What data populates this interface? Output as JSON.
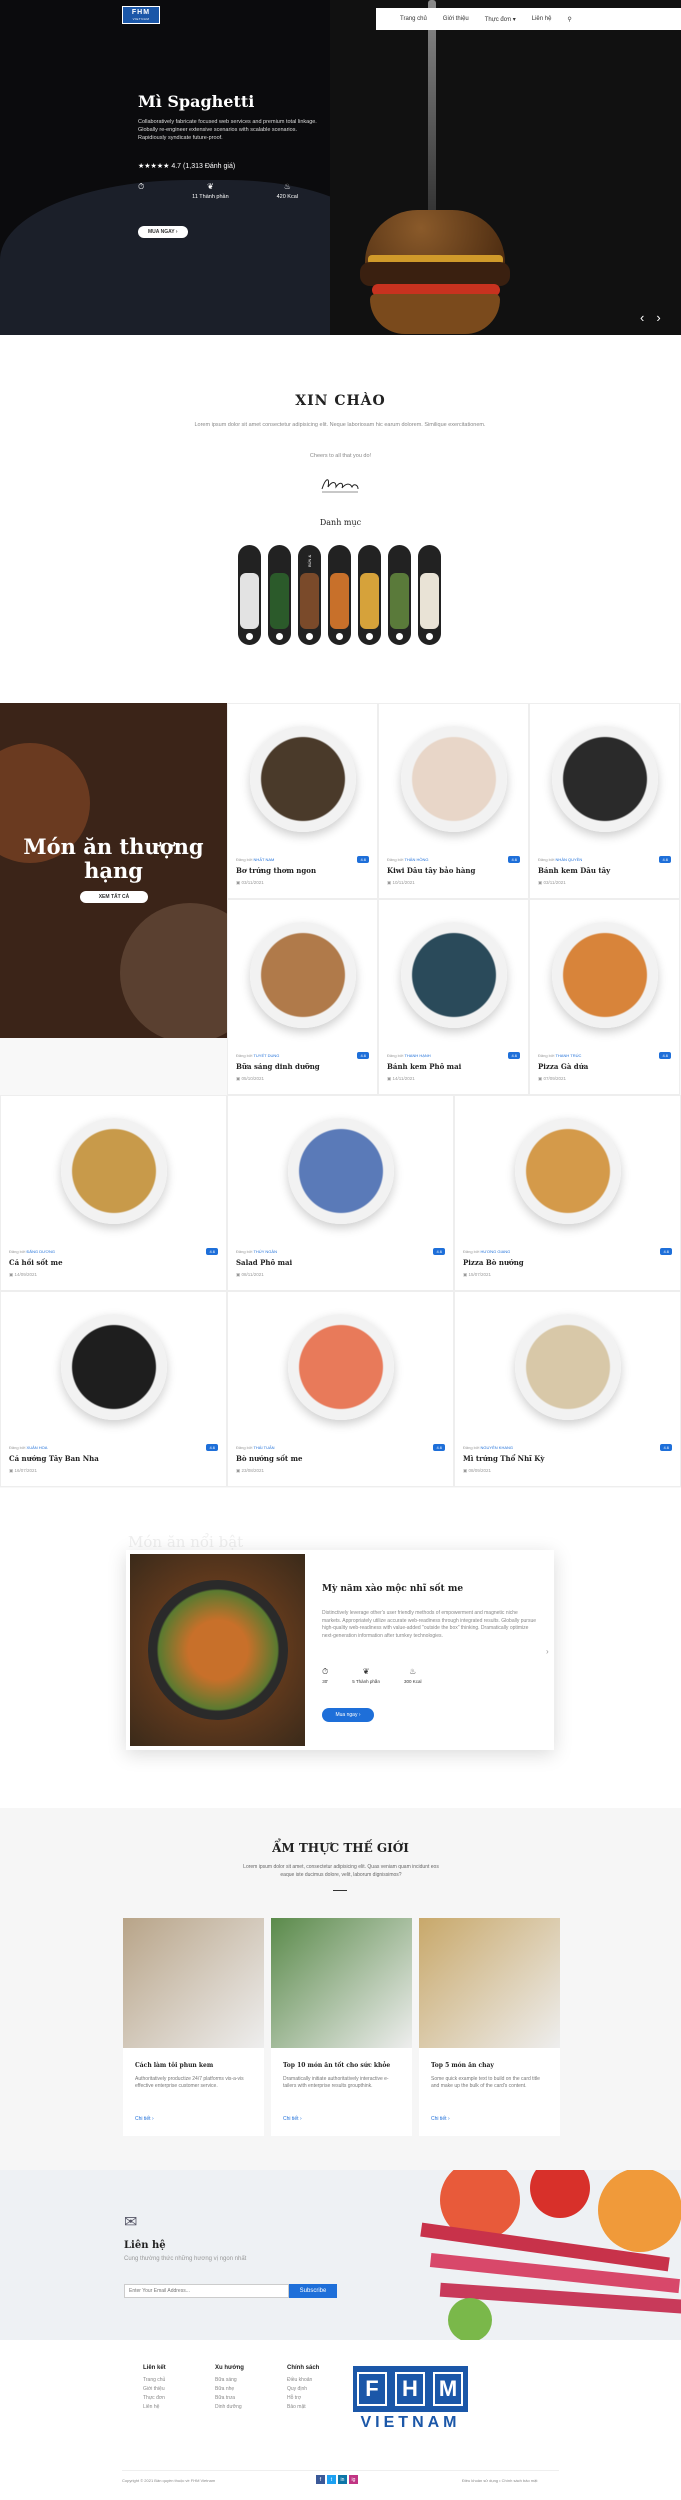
{
  "header": {
    "logo_main": "FHM",
    "logo_sub": "VIETNAM",
    "nav": [
      "Trang chủ",
      "Giới thiệu",
      "Thực đơn",
      "Liên hệ"
    ],
    "nav_dropdown_icon": "chevron-down-icon",
    "search_icon": "search-icon"
  },
  "hero": {
    "title": "Mì Spaghetti",
    "description": "Collaboratively fabricate focused web services and premium total linkage. Globally re-engineer extensive scenarios with scalable scenarios. Rapidiously syndicate future-proof.",
    "stars": "★★★★★",
    "rating_text": "4.7 (1,313 Đánh giá)",
    "stats": [
      {
        "icon": "timer-icon",
        "label": ""
      },
      {
        "icon": "ingredients-icon",
        "label": "11 Thành phần"
      },
      {
        "icon": "calories-icon",
        "label": "420 Kcal"
      }
    ],
    "button": "MUA NGAY ›",
    "prev": "‹",
    "next": "›"
  },
  "intro": {
    "title": "XIN CHÀO",
    "text": "Lorem ipsum dolor sit amet consectetur adipisicing elit. Neque laboriosam hic earum dolorem. Similique exercitationem.",
    "cheers": "Cheers to all that you do!",
    "category_title": "Danh mục",
    "categories": [
      {
        "label": "",
        "color": "#e3e3e3"
      },
      {
        "label": "",
        "color": "#2b5a2a"
      },
      {
        "label": "BÚN & BÁNH",
        "color": "#7a4a2a"
      },
      {
        "label": "",
        "color": "#c8702a"
      },
      {
        "label": "",
        "color": "#d6a23a"
      },
      {
        "label": "",
        "color": "#5a7a3a"
      },
      {
        "label": "",
        "color": "#e9e3d6"
      }
    ]
  },
  "featured": {
    "title": "Món ăn thượng hạng",
    "button": "XEM TẤT CẢ"
  },
  "dishes": [
    {
      "by": "Đăng bởi",
      "author": "NHẤT NAM",
      "badge": "4.6",
      "name": "Bơ trứng thơm ngon",
      "date": "03/11/2021",
      "color": "#4a3a2a"
    },
    {
      "by": "Đăng bởi",
      "author": "THÂN HỒNG",
      "badge": "4.6",
      "name": "Kiwi Dâu tây bảo hàng",
      "date": "10/11/2021",
      "color": "#e8d6c8"
    },
    {
      "by": "Đăng bởi",
      "author": "NHÂN QUYỀN",
      "badge": "4.6",
      "name": "Bánh kem Dâu tây",
      "date": "03/11/2021",
      "color": "#2a2a2a"
    },
    {
      "by": "Đăng bởi",
      "author": "TUYẾT DUNG",
      "badge": "4.6",
      "name": "Bữa sáng dinh dưỡng",
      "date": "05/10/2021",
      "color": "#b07a4a"
    },
    {
      "by": "Đăng bởi",
      "author": "THANH HẠNH",
      "badge": "4.6",
      "name": "Bánh kem Phô mai",
      "date": "14/11/2021",
      "color": "#2a4a5a"
    },
    {
      "by": "Đăng bởi",
      "author": "THANH TRÚC",
      "badge": "4.6",
      "name": "Pizza Gà dứa",
      "date": "07/09/2021",
      "color": "#d8843a"
    },
    {
      "by": "Đăng bởi",
      "author": "ĐĂNG DƯƠNG",
      "badge": "4.6",
      "name": "Cá hồi sốt me",
      "date": "14/09/2021",
      "color": "#c89a4a"
    },
    {
      "by": "Đăng bởi",
      "author": "THÚY NGÂN",
      "badge": "4.6",
      "name": "Salad Phô mai",
      "date": "08/11/2021",
      "color": "#5a7ab8"
    },
    {
      "by": "Đăng bởi",
      "author": "HƯƠNG GIANG",
      "badge": "4.6",
      "name": "Pizza Bò nướng",
      "date": "15/07/2021",
      "color": "#d49a4a"
    },
    {
      "by": "Đăng bởi",
      "author": "XUÂN HOA",
      "badge": "4.6",
      "name": "Cá nướng Tây Ban Nha",
      "date": "16/07/2021",
      "color": "#1e1e1e"
    },
    {
      "by": "Đăng bởi",
      "author": "THÁI TUẤN",
      "badge": "4.6",
      "name": "Bò nướng sốt me",
      "date": "23/08/2021",
      "color": "#e87a5a"
    },
    {
      "by": "Đăng bởi",
      "author": "NGUYÊN KHANG",
      "badge": "4.6",
      "name": "Mì trứng Thổ Nhĩ Kỳ",
      "date": "08/09/2021",
      "color": "#d8c8a8"
    }
  ],
  "slider": {
    "ghost": "Món ăn nổi bật",
    "title": "Mỳ năm xào mộc nhĩ sốt me",
    "text": "Distinctively leverage other's user friendly methods of empowerment and magnetic niche markets. Appropriately utilize accurate web-readiness through integrated results. Globally pursue high-quality web-readiness with value-added \"outside the box\" thinking. Dramatically optimize next-generation information after turnkey technologies.",
    "stats": [
      {
        "icon": "timer-icon",
        "label": "30'"
      },
      {
        "icon": "ingredients-icon",
        "label": "5 Thành phần"
      },
      {
        "icon": "calories-icon",
        "label": "300 Kcal"
      }
    ],
    "button": "Mua ngay ›",
    "next": "›"
  },
  "world": {
    "title": "ẨM THỰC THẾ GIỚI",
    "text": "Lorem ipsum dolor sit amet, consectetur adipisicing elit. Quas veniam quam incidunt eos eaque iste ducimus dolore, velit, laborum dignissimos?",
    "cards": [
      {
        "title": "Cách làm tôi phun kem",
        "text": "Authoritatively productize 24/7 platforms vis-a-vis effective enterprise customer service.",
        "more": "Chi tiết  ›",
        "color": "#b8a488"
      },
      {
        "title": "Top 10 món ăn tốt cho sức khỏe",
        "text": "Dramatically initiate authoritatively interactive e-tailers with enterprise results groupthink.",
        "more": "Chi tiết  ›",
        "color": "#5a8a4a"
      },
      {
        "title": "Top 5 món ăn chay",
        "text": "Some quick example text to build on the card title and make up the bulk of the card's content.",
        "more": "Chi tiết  ›",
        "color": "#c8a86a"
      }
    ]
  },
  "newsletter": {
    "icon": "mail-icon",
    "title": "Liên hệ",
    "text": "Cung thường thức những hương vị ngon nhất",
    "placeholder": "Enter Your Email Address...",
    "button": "Subscribe"
  },
  "footer": {
    "columns": [
      {
        "title": "Liên kết",
        "items": [
          "Trang chủ",
          "Giới thiệu",
          "Thực đơn",
          "Liên hệ"
        ]
      },
      {
        "title": "Xu hướng",
        "items": [
          "Bữa sáng",
          "Bữa nhẹ",
          "Bữa trưa",
          "Dinh dưỡng"
        ]
      },
      {
        "title": "Chính sách",
        "items": [
          "Điều khoản",
          "Quy định",
          "Hỗ trợ",
          "Bảo mật"
        ]
      }
    ],
    "logo_letters": [
      "F",
      "H",
      "M"
    ],
    "logo_sub": "VIETNAM",
    "copyright": "Copyright © 2021 Bản quyền thuộc về FHM Vietnam",
    "social": [
      "f",
      "t",
      "in",
      "ig"
    ],
    "terms": "Điều khoản sử dụng  •  Chính sách bảo mật"
  }
}
